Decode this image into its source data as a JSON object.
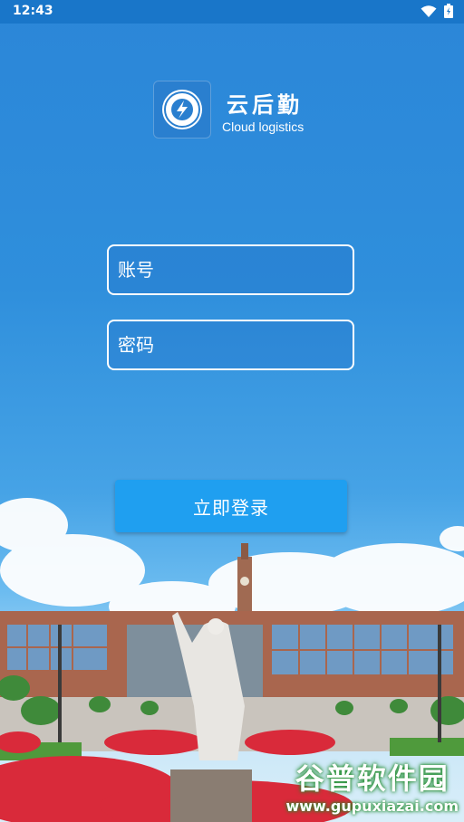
{
  "status_bar": {
    "time": "12:43",
    "icons": [
      "wifi-icon",
      "battery-icon"
    ]
  },
  "header": {
    "logo_icon": "school-emblem-icon",
    "app_name": "云后勤",
    "app_subtitle": "Cloud logistics"
  },
  "form": {
    "account_placeholder": "账号",
    "password_placeholder": "密码",
    "login_label": "立即登录"
  },
  "watermark": {
    "title": "谷普软件园",
    "url": "www.gupuxiazai.com"
  },
  "colors": {
    "status_bar": "#1976c9",
    "button": "#1f9ff0",
    "sky": "#2f8fdc"
  }
}
